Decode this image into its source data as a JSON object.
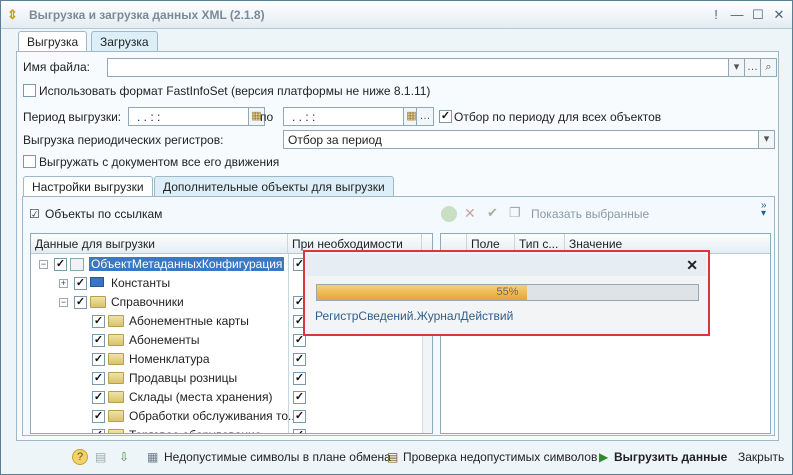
{
  "window": {
    "title": "Выгрузка и загрузка данных XML (2.1.8)"
  },
  "tabs": [
    "Выгрузка",
    "Загрузка"
  ],
  "form": {
    "file_label": "Имя файла:",
    "file_value": "",
    "fastinfoset_label": "Использовать формат FastInfoSet (версия платформы не ниже 8.1.11)",
    "fastinfoset_checked": false,
    "period_label": "Период выгрузки:",
    "period_from": ".  .      :  :",
    "period_to_label": "по",
    "period_to": ".  .      :  :",
    "period_filter_label": "Отбор по периоду для всех объектов",
    "period_filter_checked": true,
    "periodic_label": "Выгрузка периодических регистров:",
    "periodic_value": "Отбор за период",
    "with_movements_label": "Выгружать с документом все его движения",
    "with_movements_checked": false
  },
  "inner_tabs": [
    "Настройки выгрузки",
    "Дополнительные объекты для выгрузки"
  ],
  "toolbar": {
    "by_refs_label": "Объекты по ссылкам",
    "show_selected_label": "Показать выбранные"
  },
  "tree": {
    "headers": [
      "Данные для выгрузки",
      "При необходимости"
    ],
    "rows": [
      {
        "label": "ОбъектМетаданныхКонфигурация",
        "level": 0,
        "expander": "−",
        "checked": true,
        "need": true,
        "selected": true
      },
      {
        "label": "Константы",
        "level": 1,
        "expander": "+",
        "checked": true,
        "need": false,
        "selected": false
      },
      {
        "label": "Справочники",
        "level": 1,
        "expander": "−",
        "checked": true,
        "need": true,
        "selected": false
      },
      {
        "label": "Абонементные карты",
        "level": 2,
        "expander": "",
        "checked": true,
        "need": true,
        "selected": false
      },
      {
        "label": "Абонементы",
        "level": 2,
        "expander": "",
        "checked": true,
        "need": true,
        "selected": false
      },
      {
        "label": "Номенклатура",
        "level": 2,
        "expander": "",
        "checked": true,
        "need": true,
        "selected": false
      },
      {
        "label": "Продавцы розницы",
        "level": 2,
        "expander": "",
        "checked": true,
        "need": true,
        "selected": false
      },
      {
        "label": "Склады (места хранения)",
        "level": 2,
        "expander": "",
        "checked": true,
        "need": true,
        "selected": false
      },
      {
        "label": "Обработки обслуживания то...",
        "level": 2,
        "expander": "",
        "checked": true,
        "need": true,
        "selected": false
      },
      {
        "label": "Торговое оборудование",
        "level": 2,
        "expander": "",
        "checked": true,
        "need": true,
        "selected": false
      }
    ]
  },
  "right_grid": {
    "headers": [
      "Поле",
      "Тип с...",
      "Значение"
    ]
  },
  "popup": {
    "close": "✕",
    "percent_text": "55%",
    "progress": 0.55,
    "status": "РегистрСведений.ЖурналДействий"
  },
  "bottom": {
    "invalid_symbols": "Недопустимые символы в плане обмена",
    "check_invalid": "Проверка недопустимых символов",
    "export": "Выгрузить данные",
    "close": "Закрыть"
  },
  "colors": {
    "accent": "#2f6f9e",
    "selection": "#3a78c2",
    "progress": "#e8a437",
    "popup_border": "#d9363e"
  }
}
